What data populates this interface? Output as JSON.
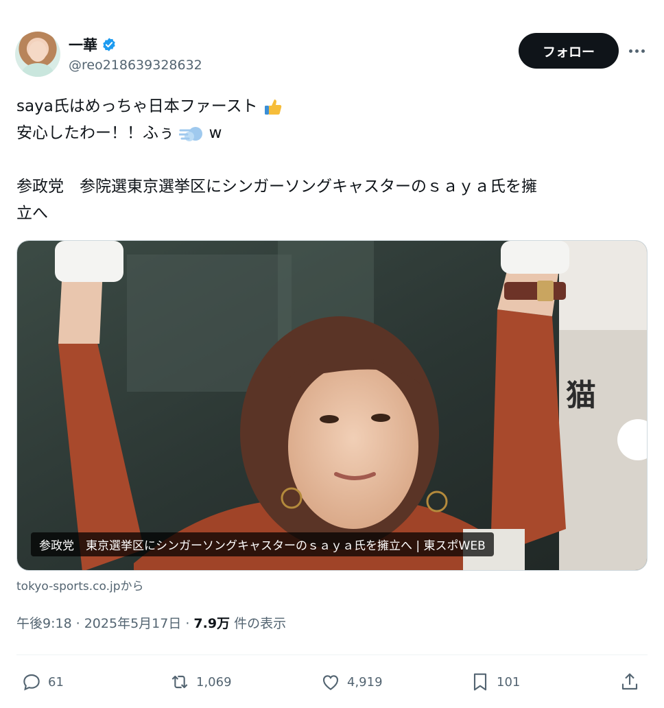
{
  "user": {
    "display_name": "一華",
    "handle": "@reo218639328632",
    "verified_icon": "verified-badge-icon",
    "follow_label": "フォロー"
  },
  "tweet": {
    "line1": "saya氏はめっちゃ日本ファースト",
    "line1_emoji": "thumbs-up",
    "line2_a": "安心したわー！！ふぅ",
    "line2_emoji": "dash",
    "line2_b": "w",
    "line3": "参政党　参院選東京選挙区にシンガーソングキャスターのｓａｙａ氏を擁",
    "line4": "立へ"
  },
  "card": {
    "caption": "参政党　東京選挙区にシンガーソングキャスターのｓａｙａ氏を擁立へ | 東スポWEB",
    "source": "tokyo-sports.co.jpから"
  },
  "meta": {
    "time": "午後9:18",
    "sep1": "·",
    "date": "2025年5月17日",
    "sep2": "·",
    "views": "7.9万",
    "views_label": "件の表示"
  },
  "actions": {
    "replies": "61",
    "reposts": "1,069",
    "likes": "4,919",
    "bookmarks": "101"
  },
  "colors": {
    "accent": "#1d9bf0",
    "text": "#0f1419",
    "muted": "#536471",
    "follow_bg": "#0f1419"
  }
}
